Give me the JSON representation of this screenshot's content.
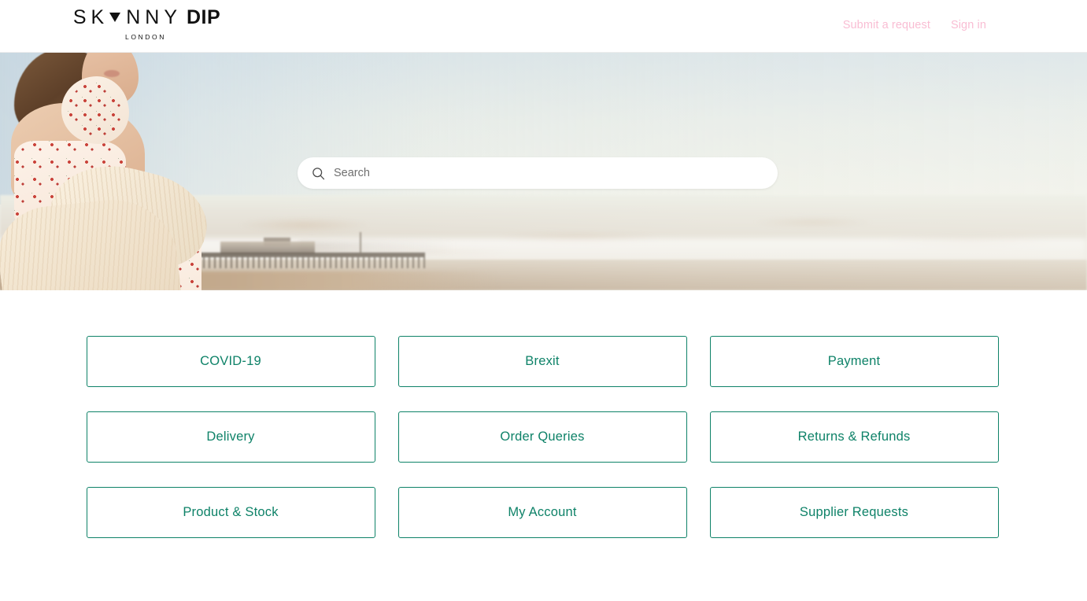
{
  "header": {
    "logo": {
      "letters_before": [
        "S",
        "K"
      ],
      "triangle_icon": "triangle-down-icon",
      "letters_after": [
        "N",
        "N",
        "Y"
      ],
      "bold_word": "DIP",
      "subtitle": "LONDON",
      "full_text": "SKINNY DIP LONDON"
    },
    "nav": [
      {
        "label": "Submit a request",
        "name": "submit-a-request-link"
      },
      {
        "label": "Sign in",
        "name": "sign-in-link"
      }
    ],
    "nav_color": "#f9bdd3"
  },
  "hero": {
    "alt": "Woman on Brighton beach wearing cream knit cardigan over cherry-print dress with the pier behind",
    "search": {
      "placeholder": "Search",
      "value": "",
      "icon": "search-icon"
    }
  },
  "categories": {
    "accent_color": "#0e8268",
    "items": [
      {
        "label": "COVID-19",
        "name": "category-card-covid-19"
      },
      {
        "label": "Brexit",
        "name": "category-card-brexit"
      },
      {
        "label": "Payment",
        "name": "category-card-payment"
      },
      {
        "label": "Delivery",
        "name": "category-card-delivery"
      },
      {
        "label": "Order Queries",
        "name": "category-card-order-queries"
      },
      {
        "label": "Returns & Refunds",
        "name": "category-card-returns-refunds"
      },
      {
        "label": "Product & Stock",
        "name": "category-card-product-stock"
      },
      {
        "label": "My Account",
        "name": "category-card-my-account"
      },
      {
        "label": "Supplier Requests",
        "name": "category-card-supplier-requests"
      }
    ]
  }
}
